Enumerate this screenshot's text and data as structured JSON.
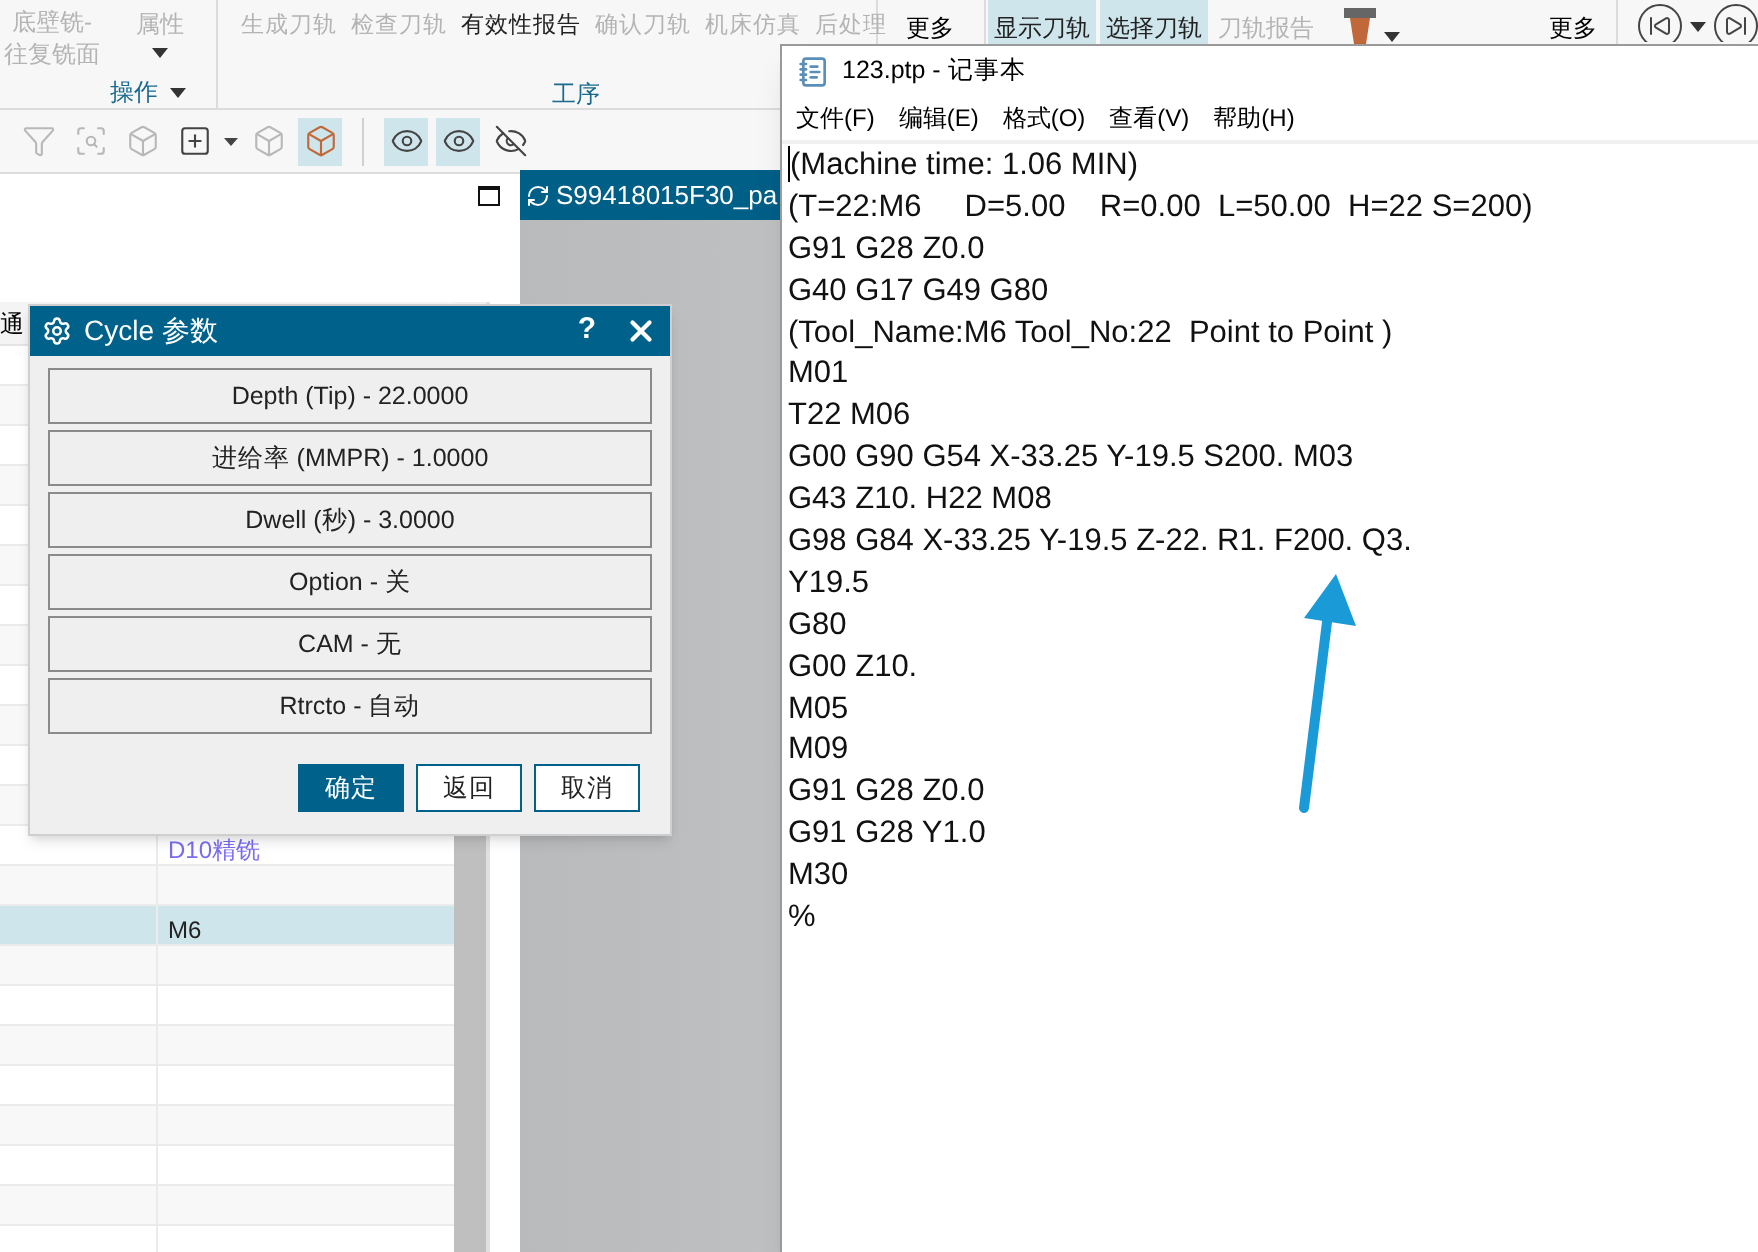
{
  "ribbon": {
    "op_button": {
      "label": "底壁铣-往复铣面",
      "disabled": true
    },
    "prop_button": {
      "label": "属性",
      "disabled": true
    },
    "group_labels": [
      "操作",
      "工序"
    ],
    "actions": [
      {
        "label": "生成刀轨",
        "disabled": true
      },
      {
        "label": "检查刀轨",
        "disabled": true
      },
      {
        "label": "有效性报告",
        "disabled": false
      },
      {
        "label": "确认刀轨",
        "disabled": true
      },
      {
        "label": "机床仿真",
        "disabled": true
      },
      {
        "label": "后处理",
        "disabled": true
      }
    ],
    "more_1": "更多",
    "view_actions": [
      {
        "label": "显示刀轨",
        "selected": true,
        "disabled": false
      },
      {
        "label": "选择刀轨",
        "selected": true,
        "disabled": false
      },
      {
        "label": "刀轨报告",
        "selected": false,
        "disabled": true
      }
    ],
    "more_2": "更多"
  },
  "toolbar": {
    "tools": [
      {
        "kind": "filter",
        "selected": false,
        "disabled": true
      },
      {
        "kind": "select",
        "selected": false,
        "disabled": true
      },
      {
        "kind": "cube-add",
        "selected": false,
        "disabled": true
      },
      {
        "kind": "box-add",
        "selected": false,
        "disabled": false,
        "has_menu": true
      },
      {
        "kind": "cube",
        "selected": false,
        "disabled": true
      },
      {
        "kind": "cube",
        "selected": true,
        "disabled": false,
        "separator_after": true
      },
      {
        "kind": "eye",
        "selected": true,
        "disabled": false
      },
      {
        "kind": "eye",
        "selected": true,
        "disabled": false
      },
      {
        "kind": "eye-off",
        "selected": false,
        "disabled": false
      }
    ]
  },
  "panel": {
    "header_fragment": "通",
    "rows": [
      {
        "selected": false
      },
      {
        "selected": false
      },
      {
        "selected": false
      },
      {
        "selected": false
      },
      {
        "selected": false
      },
      {
        "selected": false
      },
      {
        "selected": false
      },
      {
        "selected": false
      },
      {
        "selected": false
      },
      {
        "selected": false
      },
      {
        "selected": false
      },
      {
        "selected": false
      },
      {
        "value": "D10精铣",
        "link": true,
        "selected": false
      },
      {
        "selected": false
      },
      {
        "value": "M6",
        "link": false,
        "selected": true
      },
      {
        "selected": false
      },
      {
        "selected": false
      },
      {
        "selected": false
      },
      {
        "selected": false
      },
      {
        "selected": false
      },
      {
        "selected": false
      },
      {
        "selected": false
      },
      {
        "selected": false
      }
    ]
  },
  "graphics_tab": {
    "label": "S99418015F30_pa"
  },
  "dialog": {
    "title": "Cycle 参数",
    "help": "?",
    "params": [
      "Depth (Tip) - 22.0000",
      "进给率 (MMPR) - 1.0000",
      "Dwell (秒) - 3.0000",
      "Option - 关",
      "CAM - 无",
      "Rtrcto - 自动"
    ],
    "buttons": [
      {
        "label": "确定",
        "kind": "primary"
      },
      {
        "label": "返回",
        "kind": "plain"
      },
      {
        "label": "取消",
        "kind": "plain"
      }
    ]
  },
  "notepad": {
    "title": "123.ptp - 记事本",
    "menu": [
      "文件(F)",
      "编辑(E)",
      "格式(O)",
      "查看(V)",
      "帮助(H)"
    ],
    "lines": [
      "(Machine time: 1.06 MIN)",
      "(T=22:M6     D=5.00    R=0.00  L=50.00  H=22 S=200)",
      "G91 G28 Z0.0",
      "G40 G17 G49 G80",
      "(Tool_Name:M6 Tool_No:22  Point to Point )",
      "M01",
      "T22 M06",
      "G00 G90 G54 X-33.25 Y-19.5 S200. M03",
      "G43 Z10. H22 M08",
      "G98 G84 X-33.25 Y-19.5 Z-22. R1. F200. Q3.",
      "Y19.5",
      "G80",
      "G00 Z10.",
      "M05",
      "M09",
      "G91 G28 Z0.0",
      "G91 G28 Y1.0",
      "M30",
      "%"
    ]
  }
}
